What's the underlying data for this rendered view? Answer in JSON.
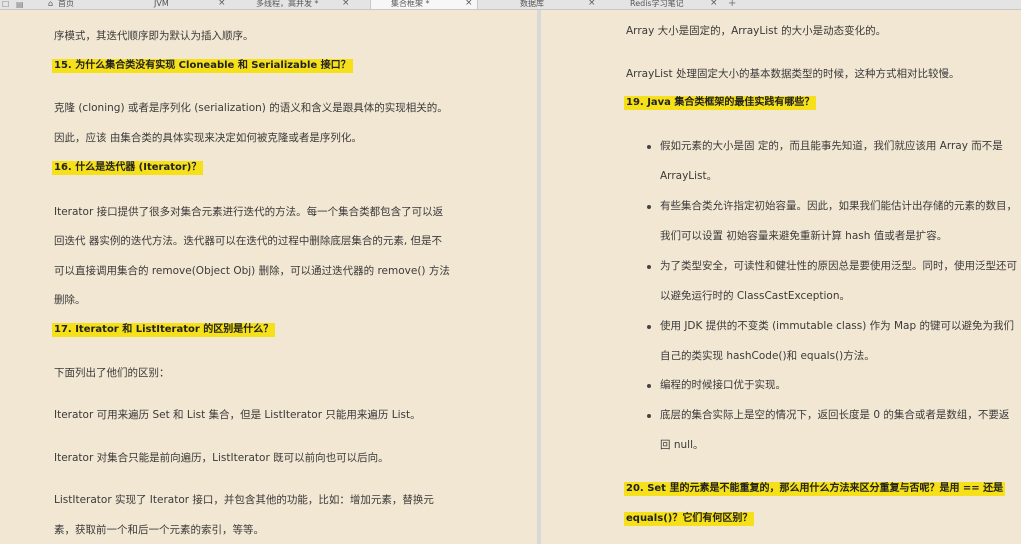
{
  "tabs": [
    {
      "label": "首页",
      "close": ""
    },
    {
      "label": "JVM",
      "close": "×"
    },
    {
      "label": "多线程，高并发 *",
      "close": "×"
    },
    {
      "label": "集合框架 *",
      "close": "×"
    },
    {
      "label": "数据库",
      "close": "×"
    },
    {
      "label": "Redis学习笔记",
      "close": "×"
    }
  ],
  "new_tab_symbol": "+",
  "left": {
    "l1": "序模式，其迭代顺序即为默认为插入顺序。",
    "h15": "15. 为什么集合类没有实现 Cloneable 和 Serializable 接口？",
    "p15a": "克隆 (cloning) 或者是序列化 (serialization) 的语义和含义是跟具体的实现相关的。",
    "p15b": "因此，应该 由集合类的具体实现来决定如何被克隆或者是序列化。",
    "h16": "16. 什么是迭代器 (Iterator)？",
    "p16a": "Iterator 接口提供了很多对集合元素进行迭代的方法。每一个集合类都包含了可以返",
    "p16b": "回迭代 器实例的迭代方法。迭代器可以在迭代的过程中删除底层集合的元素, 但是不",
    "p16c": "可以直接调用集合的 remove(Object Obj) 删除，可以通过迭代器的 remove() 方法",
    "p16d": "删除。",
    "h17": "17. Iterator 和 ListIterator 的区别是什么？",
    "p17a": "下面列出了他们的区别：",
    "p17b": "Iterator 可用来遍历 Set 和 List 集合，但是 ListIterator 只能用来遍历 List。",
    "p17c": "Iterator 对集合只能是前向遍历，ListIterator 既可以前向也可以后向。",
    "p17d": "ListIterator 实现了 Iterator 接口，并包含其他的功能，比如：增加元素，替换元",
    "p17e": "素，获取前一个和后一个元素的索引，等等。"
  },
  "right": {
    "r1": "Array 大小是固定的，ArrayList 的大小是动态变化的。",
    "r2": "ArrayList 处理固定大小的基本数据类型的时候，这种方式相对比较慢。",
    "h19": "19. Java 集合类框架的最佳实践有哪些？",
    "b1a": "假如元素的大小是固 定的，而且能事先知道，我们就应该用 Array 而不是",
    "b1b": "ArrayList。",
    "b2a": "有些集合类允许指定初始容量。因此，如果我们能估计出存储的元素的数目，",
    "b2b": "我们可以设置 初始容量来避免重新计算 hash 值或者是扩容。",
    "b3a": "为了类型安全，可读性和健壮性的原因总是要使用泛型。同时，使用泛型还可",
    "b3b": "以避免运行时的 ClassCastException。",
    "b4a": "使用 JDK 提供的不变类 (immutable class) 作为 Map 的键可以避免为我们",
    "b4b": "自己的类实现 hashCode()和 equals()方法。",
    "b5a": "编程的时候接口优于实现。",
    "b6a": "底层的集合实际上是空的情况下，返回长度是 0 的集合或者是数组，不要返",
    "b6b": "回 null。",
    "h20a": "20. Set 里的元素是不能重复的，那么用什么方法来区分重复与否呢？是用 == 还是",
    "h20b": "equals()？它们有何区别？"
  }
}
